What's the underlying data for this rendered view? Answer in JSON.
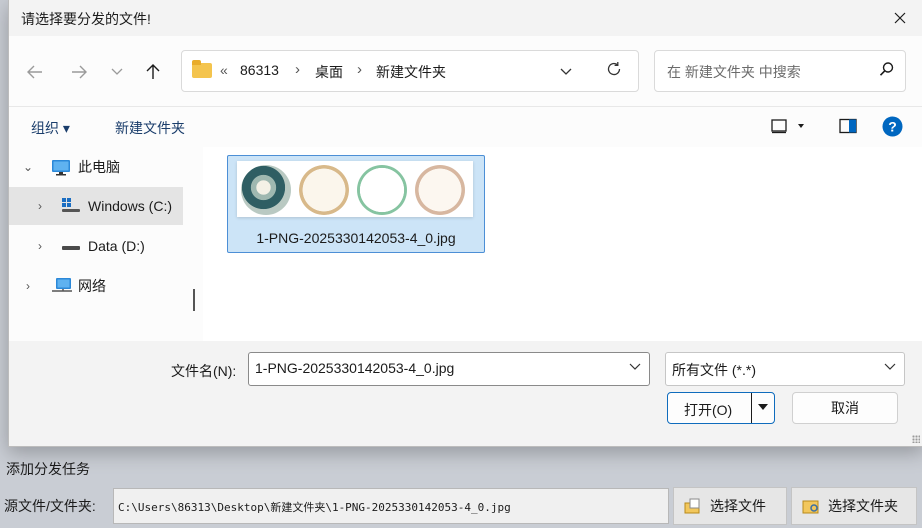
{
  "dialog": {
    "title": "请选择要分发的文件!",
    "nav": {
      "back_icon": "back-arrow-icon",
      "forward_icon": "forward-arrow-icon",
      "recent_icon": "chevron-down-icon",
      "up_icon": "up-arrow-icon"
    },
    "address": {
      "overflow": "«",
      "crumbs": [
        "86313",
        "桌面",
        "新建文件夹"
      ],
      "separator": "›"
    },
    "search_placeholder": "在 新建文件夹 中搜索",
    "toolbar": {
      "organize": "组织 ▾",
      "new_folder": "新建文件夹"
    },
    "sidebar": [
      {
        "label": "此电脑",
        "icon": "monitor-icon",
        "expanded": true
      },
      {
        "label": "Windows (C:)",
        "icon": "windows-drive-icon",
        "selected": true
      },
      {
        "label": "Data (D:)",
        "icon": "drive-icon"
      },
      {
        "label": "网络",
        "icon": "network-icon"
      }
    ],
    "file": {
      "name": "1-PNG-2025330142053-4_0.jpg"
    },
    "filename_label": "文件名(N):",
    "filename_value": "1-PNG-2025330142053-4_0.jpg",
    "filetype_value": "所有文件 (*.*)",
    "open_button": "打开(O)",
    "cancel_button": "取消"
  },
  "app": {
    "group_title": "添加分发任务",
    "source_label": "源文件/文件夹:",
    "source_value": "C:\\Users\\86313\\Desktop\\新建文件夹\\1-PNG-2025330142053-4_0.jpg",
    "select_file_button": "选择文件",
    "select_folder_button": "选择文件夹"
  },
  "colors": {
    "accent": "#0f6cbd",
    "selection": "#cce4f7",
    "help_icon": "#0067c0"
  }
}
